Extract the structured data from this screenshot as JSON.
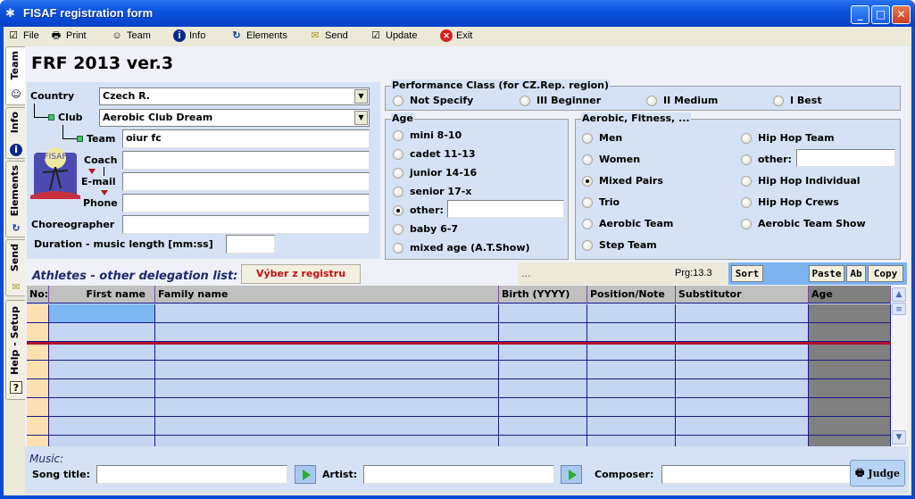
{
  "window": {
    "title": "FISAF registration form",
    "controls": {
      "minimize": "_",
      "maximize": "□",
      "close": "✕"
    }
  },
  "menu": [
    {
      "label": "File",
      "icon": "checklist-icon",
      "glyph": "☑"
    },
    {
      "label": "Print",
      "icon": "printer-icon",
      "glyph": "🖶"
    },
    {
      "label": "Team",
      "icon": "team-icon",
      "glyph": "☺"
    },
    {
      "label": "Info",
      "icon": "info-icon",
      "glyph": "i"
    },
    {
      "label": "Elements",
      "icon": "refresh-icon",
      "glyph": "↻"
    },
    {
      "label": "Send",
      "icon": "envelope-icon",
      "glyph": "✉"
    },
    {
      "label": "Update",
      "icon": "checklist-icon",
      "glyph": "☑"
    },
    {
      "label": "Exit",
      "icon": "exit-icon",
      "glyph": "✕"
    }
  ],
  "side_tabs": [
    {
      "label": "Team",
      "glyph": "☺"
    },
    {
      "label": "Info",
      "glyph": "i"
    },
    {
      "label": "Elements",
      "glyph": "↻"
    },
    {
      "label": "Send",
      "glyph": "✉"
    },
    {
      "label": "Help - Setup",
      "glyph": "?"
    }
  ],
  "app_title": "FRF 2013 ver.3",
  "team_form": {
    "country_label": "Country",
    "country_value": "Czech R.",
    "club_label": "Club",
    "club_value": "Aerobic Club Dream",
    "team_label": "Team",
    "team_value": "oiur fc",
    "coach_label": "Coach",
    "coach_value": "",
    "email_label": "E-mail",
    "email_value": "",
    "phone_label": "Phone",
    "phone_value": "",
    "choreographer_label": "Choreographer",
    "choreographer_value": "",
    "duration_label": "Duration - music length [mm:ss]",
    "duration_value": "",
    "logo_text": "FISAF"
  },
  "performance_class": {
    "title": "Performance Class (for CZ.Rep. region)",
    "options": [
      "Not Specify",
      "III  Beginner",
      "II Medium",
      "I Best"
    ],
    "selected": null
  },
  "age": {
    "title": "Age",
    "options": [
      "mini 8-10",
      "cadet 11-13",
      "junior 14-16",
      "senior 17-x",
      "other:",
      "baby 6-7",
      "mixed age (A.T.Show)"
    ],
    "selected": "other:",
    "other_value": ""
  },
  "category": {
    "title": "Aerobic, Fitness, ...",
    "left_options": [
      "Men",
      "Women",
      "Mixed Pairs",
      "Trio",
      "Aerobic Team",
      "Step Team"
    ],
    "right_options": [
      "Hip Hop Team",
      "other:",
      "Hip Hop Individual",
      "Hip Hop Crews",
      "Aerobic Team Show"
    ],
    "selected": "Mixed Pairs",
    "other_value": ""
  },
  "athletes": {
    "header": "Athletes - other delegation list:",
    "registry_button": "Výber z registru",
    "status_text": "...",
    "program_version": "Prg:13.3",
    "sort_button": "Sort",
    "paste_button": "Paste",
    "ab_button": "Ab",
    "copy_button": "Copy",
    "columns": [
      "No:",
      "First name",
      "Family name",
      "Birth (YYYY)",
      "Position/Note",
      "Substitutor",
      "Age"
    ],
    "rows": [
      [
        "",
        "",
        "",
        "",
        "",
        "",
        ""
      ],
      [
        "",
        "",
        "",
        "",
        "",
        "",
        ""
      ],
      [
        "",
        "",
        "",
        "",
        "",
        "",
        ""
      ],
      [
        "",
        "",
        "",
        "",
        "",
        "",
        ""
      ],
      [
        "",
        "",
        "",
        "",
        "",
        "",
        ""
      ],
      [
        "",
        "",
        "",
        "",
        "",
        "",
        ""
      ],
      [
        "",
        "",
        "",
        "",
        "",
        "",
        ""
      ],
      [
        "",
        "",
        "",
        "",
        "",
        "",
        ""
      ]
    ]
  },
  "music": {
    "title": "Music:",
    "song_label": "Song title:",
    "song_value": "",
    "artist_label": "Artist:",
    "artist_value": "",
    "composer_label": "Composer:",
    "composer_value": "",
    "judge_button": "Judge"
  }
}
